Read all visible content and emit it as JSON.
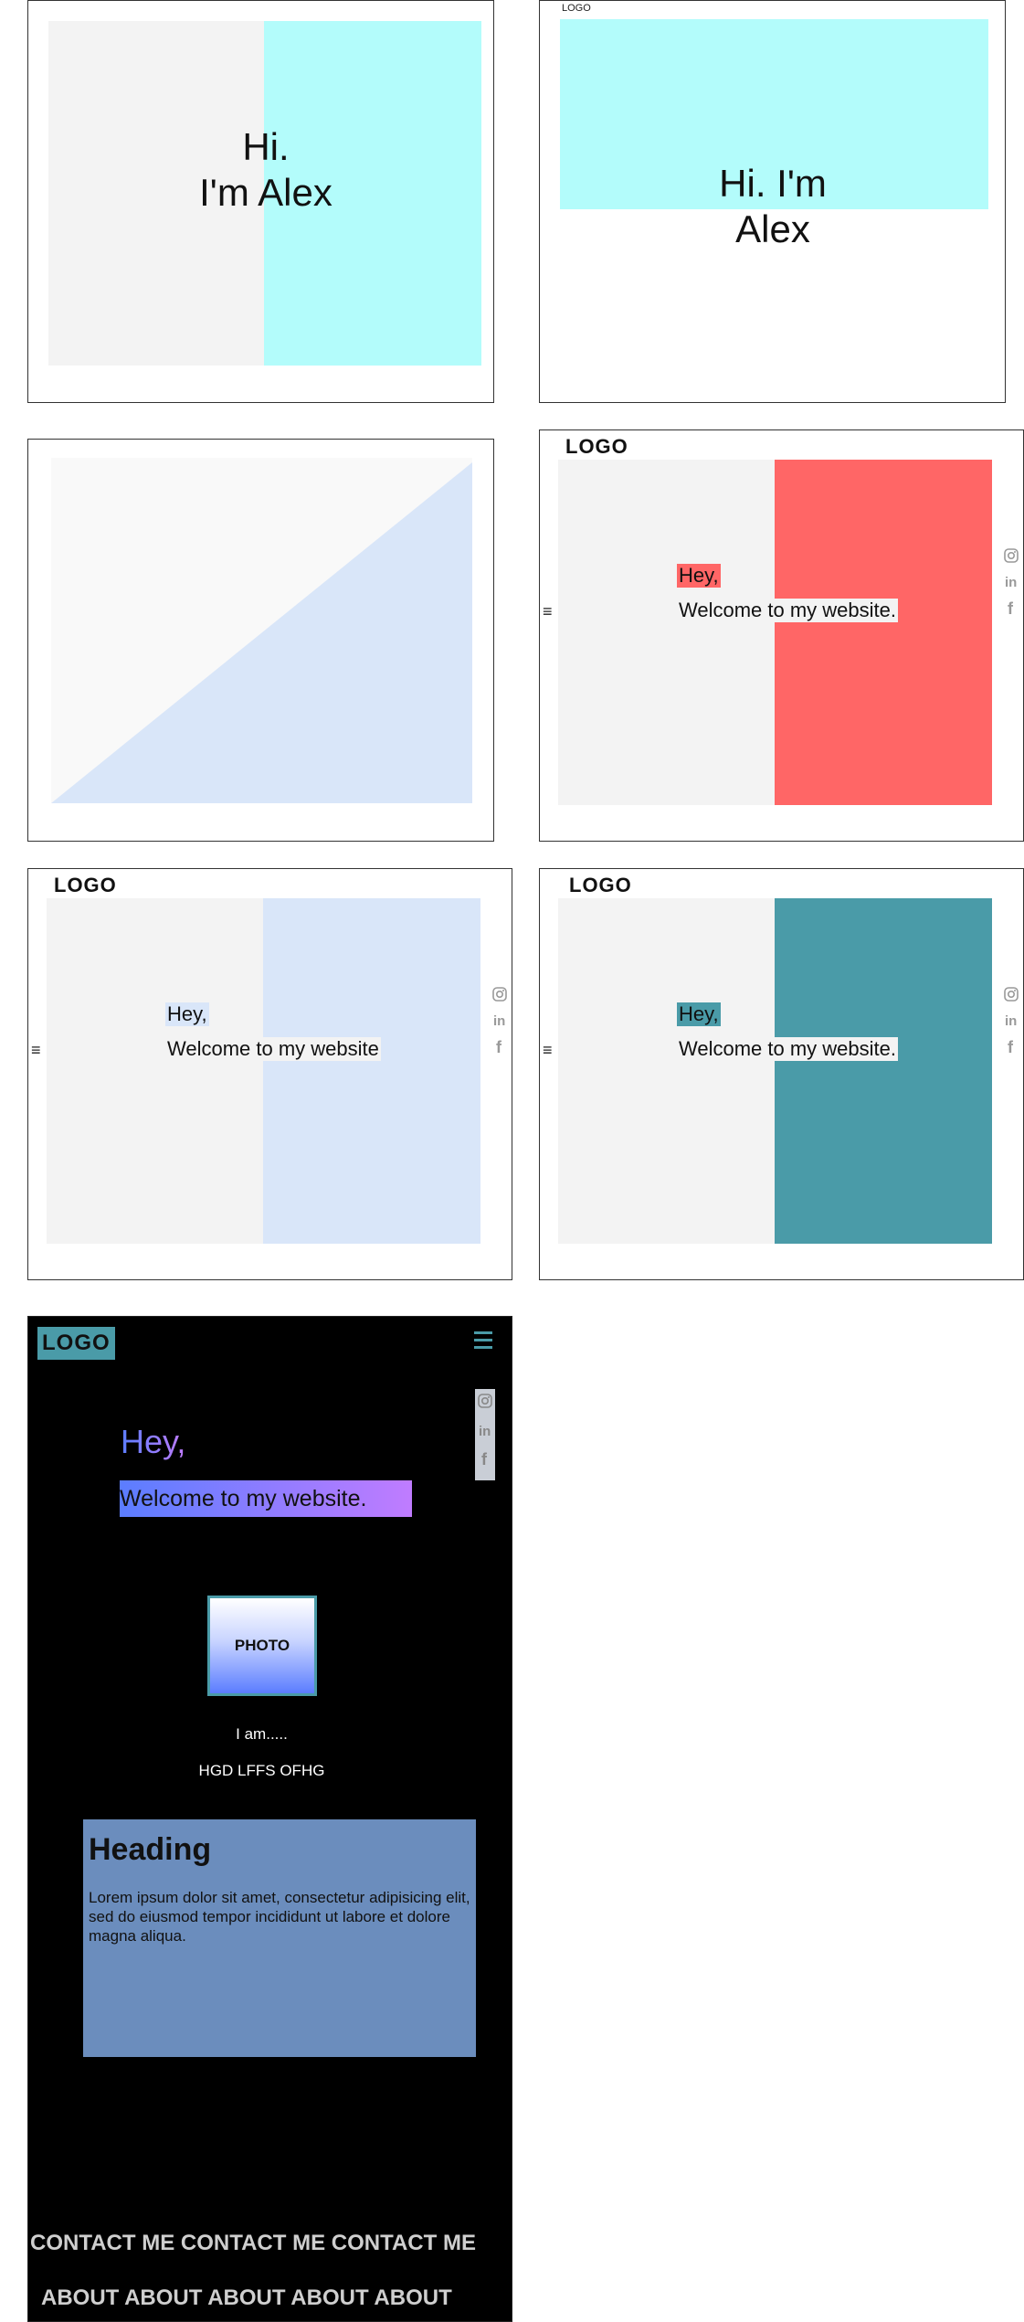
{
  "frame1": {
    "greeting_line1": "Hi.",
    "greeting_line2": "I'm Alex",
    "colors": {
      "left": "#f3f3f3",
      "right": "#b3fcfb"
    }
  },
  "frame2": {
    "logo": "LOGO",
    "greeting_line1": "Hi. I'm",
    "greeting_line2": "Alex",
    "colors": {
      "banner": "#b3fcfb"
    }
  },
  "frame3": {
    "colors": {
      "back": "#f9f9f9",
      "triangle": "#d9e6f9"
    }
  },
  "frame4": {
    "logo": "LOGO",
    "hey": "Hey,",
    "welcome": "Welcome to my website.",
    "colors": {
      "left": "#f3f3f3",
      "right": "#ff6666",
      "hey_bg": "#ff6666"
    }
  },
  "frame5": {
    "logo": "LOGO",
    "hey": "Hey,",
    "welcome": "Welcome to my website",
    "colors": {
      "left": "#f3f3f3",
      "right": "#d9e6f9",
      "hey_bg": "#d9e6f9"
    }
  },
  "frame6": {
    "logo": "LOGO",
    "hey": "Hey,",
    "welcome": "Welcome to my website.",
    "colors": {
      "left": "#f3f3f3",
      "right": "#4a9ba8",
      "hey_bg": "#4a9ba8"
    }
  },
  "frame7": {
    "logo": "LOGO",
    "hey": "Hey,",
    "welcome": "Welcome to my website.",
    "photo": "PHOTO",
    "iam": "I am.....",
    "name": "HGD LFFS OFHG",
    "card": {
      "heading": "Heading",
      "body": "Lorem ipsum dolor sit amet, consectetur adipisicing elit, sed do eiusmod tempor incididunt ut labore et dolore magna aliqua."
    },
    "contact_row": "CONTACT ME CONTACT ME CONTACT ME",
    "about_row": "ABOUT ABOUT ABOUT ABOUT ABOUT",
    "colors": {
      "bg": "#000000",
      "accent": "#4a9ba8",
      "card": "#6b8dbd",
      "grad_start": "#5b7dff",
      "grad_end": "#c07cff"
    }
  },
  "icons": {
    "menu": "hamburger-menu-icon",
    "social": [
      "instagram-icon",
      "linkedin-icon",
      "facebook-icon"
    ]
  }
}
